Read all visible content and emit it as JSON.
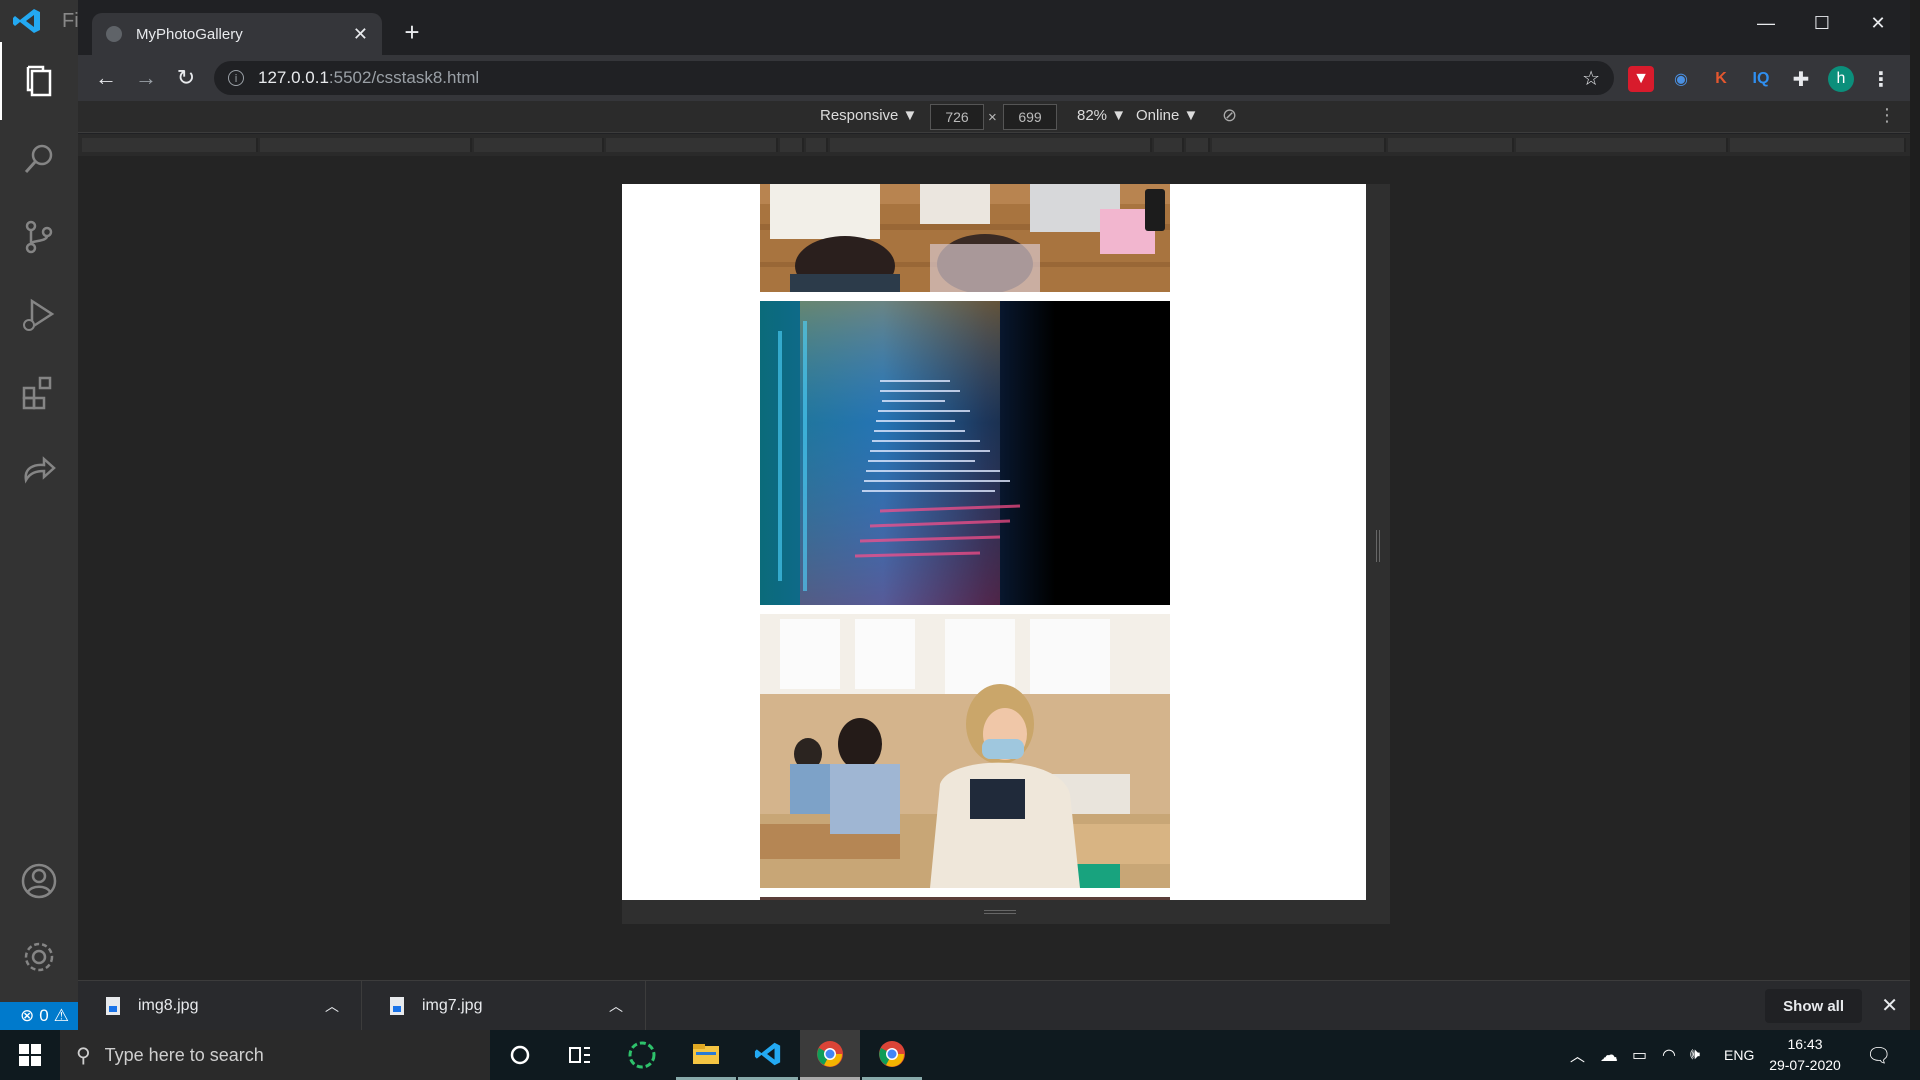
{
  "vscode": {
    "title_fragment": "Fi",
    "status_errors": "0"
  },
  "browser": {
    "tab_title": "MyPhotoGallery",
    "url_host": "127.0.0.1",
    "url_path": ":5502/csstask8.html",
    "profile_initial": "h"
  },
  "devtools": {
    "device": "Responsive ▼",
    "width": "726",
    "height": "699",
    "times": "×",
    "zoom": "82% ▼",
    "network": "Online ▼"
  },
  "downloads": [
    {
      "name": "img8.jpg"
    },
    {
      "name": "img7.jpg"
    }
  ],
  "shelf": {
    "show_all": "Show all"
  },
  "taskbar": {
    "search_placeholder": "Type here to search",
    "language": "ENG",
    "time": "16:43",
    "date": "29-07-2020"
  }
}
